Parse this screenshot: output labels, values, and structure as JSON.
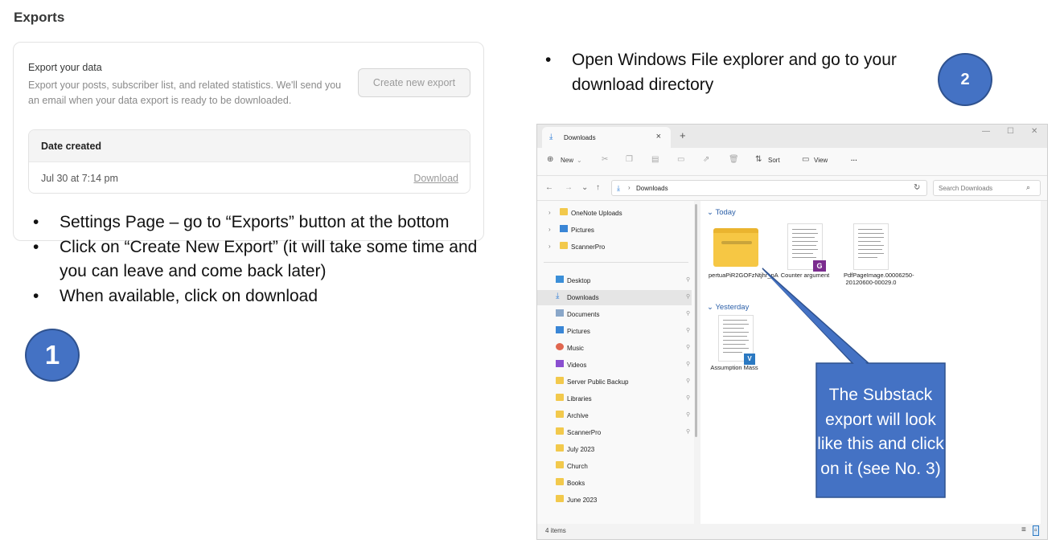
{
  "exports_panel": {
    "section_title": "Exports",
    "card_heading": "Export your data",
    "card_description": "Export your posts, subscriber list, and related statistics. We'll send you an email when your data export is ready to be downloaded.",
    "create_button_label": "Create new export",
    "table_header": "Date created",
    "rows": [
      {
        "date": "Jul 30 at 7:14 pm",
        "action": "Download"
      }
    ]
  },
  "instructions_left": [
    "Settings Page – go to “Exports” button at the bottom",
    "Click on “Create New Export” (it will take some time and you can leave and come back later)",
    "When available, click on download"
  ],
  "step1_label": "1",
  "instructions_right": [
    "Open Windows File explorer and go to your download directory"
  ],
  "step2_label": "2",
  "explorer": {
    "tab_title": "Downloads",
    "toolbar": {
      "new_label": "New",
      "sort_label": "Sort",
      "view_label": "View",
      "more_label": "···"
    },
    "address_path": "Downloads",
    "search_placeholder": "Search Downloads",
    "nav_top": [
      "OneNote Uploads",
      "Pictures",
      "ScannerPro"
    ],
    "nav_quick": [
      "Desktop",
      "Downloads",
      "Documents",
      "Pictures",
      "Music",
      "Videos",
      "Server Public Backup",
      "Libraries",
      "Archive",
      "ScannerPro",
      "July 2023",
      "Church",
      "Books",
      "June 2023"
    ],
    "group_today": "Today",
    "group_yesterday": "Yesterday",
    "files_today": [
      {
        "name": "pertuaPiR2GOFzNtjhr_pA",
        "kind": "zip-folder"
      },
      {
        "name": "Counter argument",
        "kind": "document"
      },
      {
        "name": "PdfPageImage.00006250-20120600-00029.0",
        "kind": "document"
      }
    ],
    "files_yesterday": [
      {
        "name": "Assumption Mass",
        "kind": "document"
      }
    ],
    "status_text": "4 items"
  },
  "callout_text": "The Substack export will look like this and click on it (see No.  3)",
  "colors": {
    "step_circle": "#4472c4",
    "callout": "#4472c4",
    "folder": "#f6c744",
    "link_blue": "#2b5fa8"
  }
}
